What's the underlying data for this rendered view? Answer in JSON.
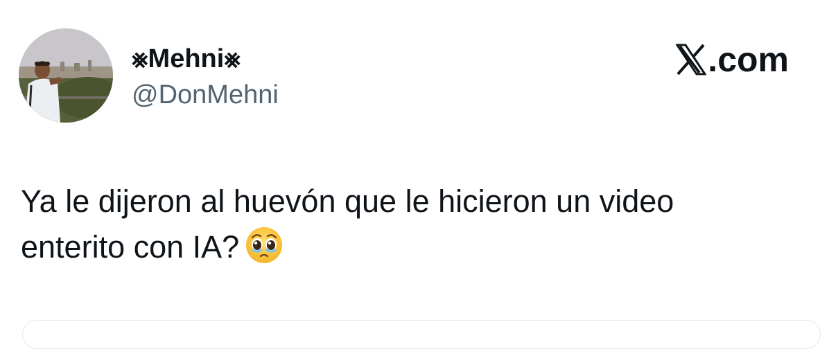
{
  "author": {
    "display_name": "⨳Mehni⨳",
    "handle": "@DonMehni",
    "avatar_icon": "profile-photo"
  },
  "brand": {
    "label": ".com",
    "icon": "x-logo-icon"
  },
  "tweet": {
    "line1": "Ya le dijeron al huevón que le hicieron un video",
    "line2": "enterito con IA?",
    "emoji_icon": "pleading-face-emoji"
  },
  "colors": {
    "text": "#0f1419",
    "secondary": "#536471",
    "border": "#e3e6e9"
  }
}
